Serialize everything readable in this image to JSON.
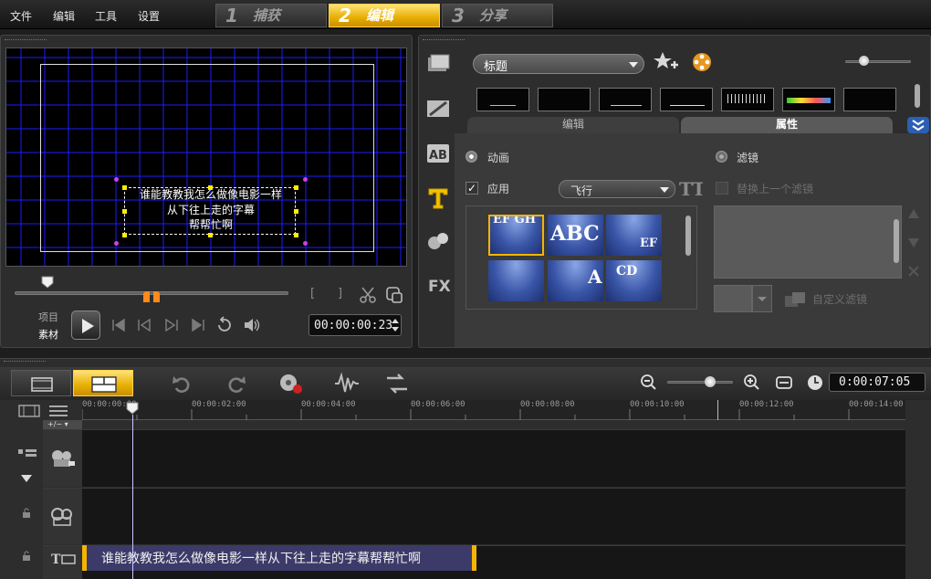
{
  "menu": [
    "文件",
    "编辑",
    "工具",
    "设置"
  ],
  "steps": [
    {
      "num": "1",
      "label": "捕获"
    },
    {
      "num": "2",
      "label": "编辑"
    },
    {
      "num": "3",
      "label": "分享"
    }
  ],
  "preview": {
    "title_lines": [
      "谁能教教我怎么做像电影一样",
      "从下往上走的字幕",
      "帮帮忙啊"
    ],
    "mode_project": "项目",
    "mode_clip": "素材",
    "timecode": "00:00:00:23"
  },
  "library": {
    "category": "标题",
    "tabs": [
      "编辑",
      "属性"
    ],
    "animation_label": "动画",
    "filter_label": "滤镜",
    "apply_label": "应用",
    "animation_type": "飞行",
    "replace_filter_label": "替换上一个滤镜",
    "custom_filter_label": "自定义滤镜",
    "anim_presets": [
      "EF GH",
      "ABC",
      "EF",
      "",
      "A",
      "CD"
    ]
  },
  "timeline": {
    "timecode": "0:00:07:05",
    "ruler": [
      "00:00:00:00",
      "00:00:02:00",
      "00:00:04:00",
      "00:00:06:00",
      "00:00:08:00",
      "00:00:10:00",
      "00:00:12:00",
      "00:00:14:00"
    ],
    "title_clip": "谁能教教我怎么做像电影一样从下往上走的字幕帮帮忙啊",
    "track_toggle": "+/−"
  },
  "colors": {
    "accent": "#f5b400",
    "grid": "#1d1dff"
  }
}
